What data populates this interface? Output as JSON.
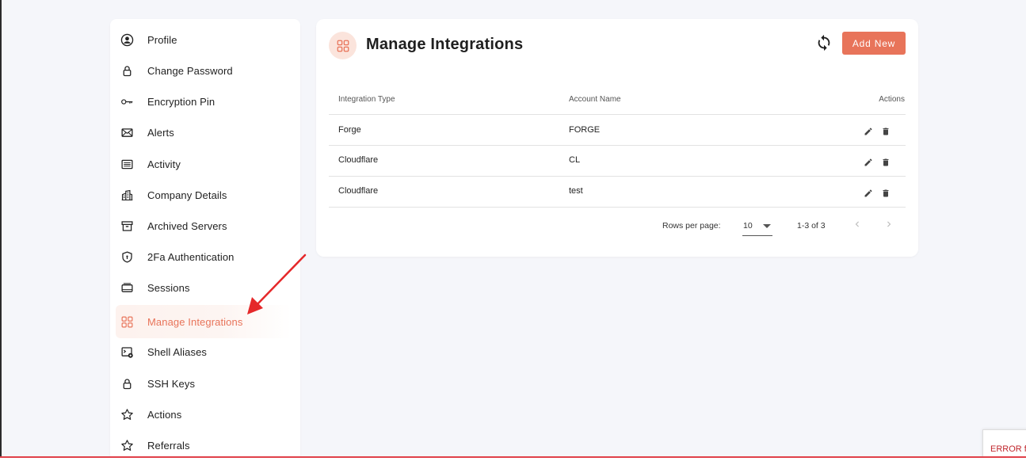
{
  "sidebar": {
    "items": [
      {
        "label": "Profile",
        "icon": "user-circle-icon"
      },
      {
        "label": "Change Password",
        "icon": "lock-icon"
      },
      {
        "label": "Encryption Pin",
        "icon": "key-icon"
      },
      {
        "label": "Alerts",
        "icon": "envelope-icon"
      },
      {
        "label": "Activity",
        "icon": "list-icon"
      },
      {
        "label": "Company Details",
        "icon": "building-icon"
      },
      {
        "label": "Archived Servers",
        "icon": "archive-icon"
      },
      {
        "label": "2Fa Authentication",
        "icon": "shield-icon"
      },
      {
        "label": "Sessions",
        "icon": "sessions-icon"
      },
      {
        "label": "Manage Integrations",
        "icon": "grid-icon",
        "active": true
      },
      {
        "label": "Shell Aliases",
        "icon": "terminal-icon"
      },
      {
        "label": "SSH Keys",
        "icon": "lock-icon"
      },
      {
        "label": "Actions",
        "icon": "star-icon"
      },
      {
        "label": "Referrals",
        "icon": "star-icon"
      }
    ]
  },
  "main": {
    "title": "Manage Integrations",
    "add_button": "Add New",
    "table": {
      "headers": [
        "Integration Type",
        "Account Name",
        "Actions"
      ],
      "rows": [
        {
          "type": "Forge",
          "account": "FORGE"
        },
        {
          "type": "Cloudflare",
          "account": "CL"
        },
        {
          "type": "Cloudflare",
          "account": "test"
        }
      ]
    },
    "pagination": {
      "rows_per_page_label": "Rows per page:",
      "rows_per_page": "10",
      "range": "1-3 of 3"
    }
  },
  "error_badge": "ERROR fo",
  "colors": {
    "accent": "#e8745a",
    "accent_light": "#fbe4dc",
    "annotation_arrow": "#e5282a"
  }
}
